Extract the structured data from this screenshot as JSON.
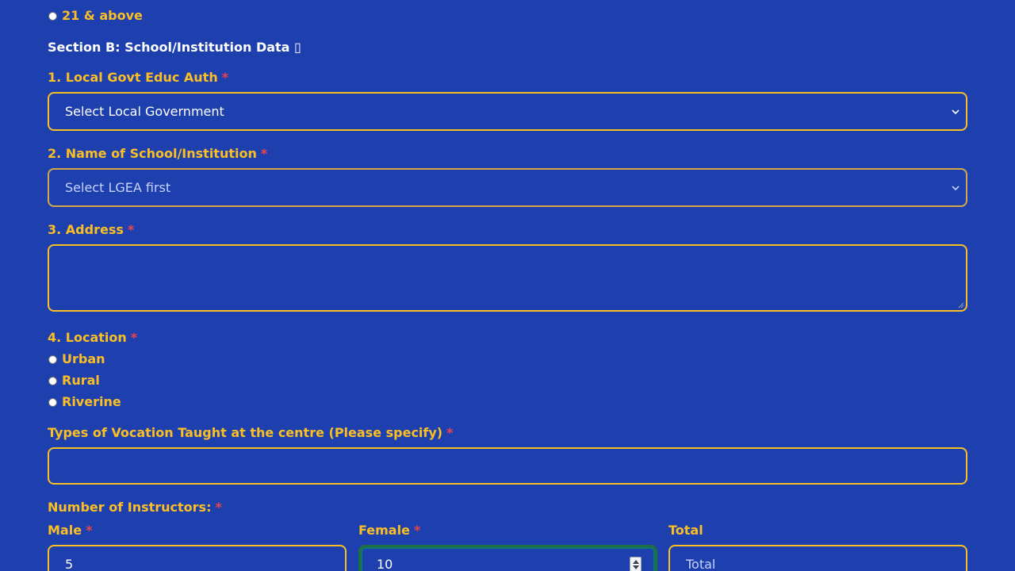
{
  "age_option": {
    "label": "21 & above"
  },
  "section_b": {
    "title": "Section B: School/Institution Data ▯"
  },
  "required_marker": "*",
  "q1": {
    "label": "1. Local Govt Educ Auth",
    "selected": "Select Local Government"
  },
  "q2": {
    "label": "2. Name of School/Institution",
    "selected": "Select LGEA first"
  },
  "q3": {
    "label": "3. Address",
    "value": ""
  },
  "q4": {
    "label": "4. Location",
    "options": [
      "Urban",
      "Rural",
      "Riverine"
    ]
  },
  "vocation": {
    "label": "Types of Vocation Taught at the centre (Please specify)",
    "value": ""
  },
  "instructors": {
    "label": "Number of Instructors:",
    "male_label": "Male",
    "male_value": "5",
    "female_label": "Female",
    "female_value": "10",
    "total_label": "Total",
    "total_placeholder": "Total"
  },
  "colors": {
    "background": "#1e40af",
    "label": "#fbbf24",
    "required": "#ef4444",
    "border": "#fbbf24",
    "focus_border": "#1f6f43"
  }
}
